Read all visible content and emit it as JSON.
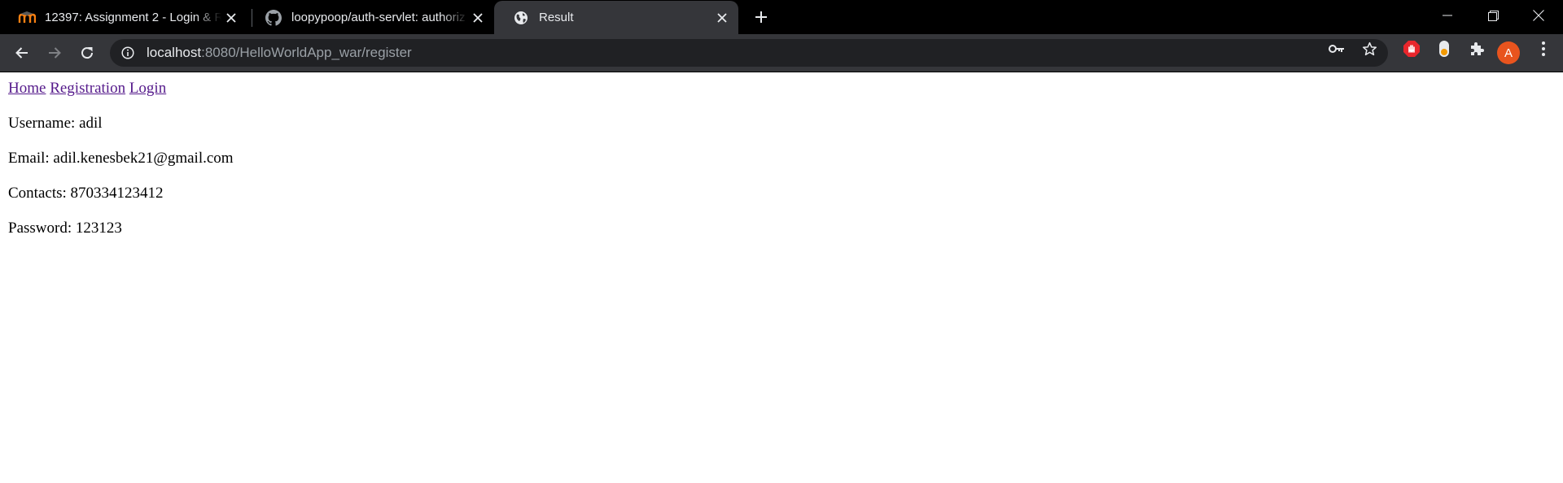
{
  "browser": {
    "tabs": [
      {
        "title": "12397: Assignment 2 - Login & R",
        "favicon": "moodle-icon",
        "active": false
      },
      {
        "title": "loopypoop/auth-servlet: authoriz",
        "favicon": "github-icon",
        "active": false
      },
      {
        "title": "Result",
        "favicon": "globe-icon",
        "active": true
      }
    ],
    "address": {
      "host": "localhost",
      "rest": ":8080/HelloWorldApp_war/register"
    },
    "profile_initial": "A",
    "colors": {
      "tabstrip": "#000000",
      "toolbar": "#35363a",
      "omnibox": "#202124",
      "avatar": "#e8541e",
      "extension_red": "#e8262c"
    }
  },
  "page": {
    "nav": [
      {
        "label": "Home"
      },
      {
        "label": "Registration"
      },
      {
        "label": "Login"
      }
    ],
    "fields": [
      {
        "label": "Username: ",
        "value": "adil"
      },
      {
        "label": "Email: ",
        "value": "adil.kenesbek21@gmail.com"
      },
      {
        "label": "Contacts: ",
        "value": "870334123412"
      },
      {
        "label": "Password: ",
        "value": "123123"
      }
    ],
    "link_color": "#551a8b"
  }
}
